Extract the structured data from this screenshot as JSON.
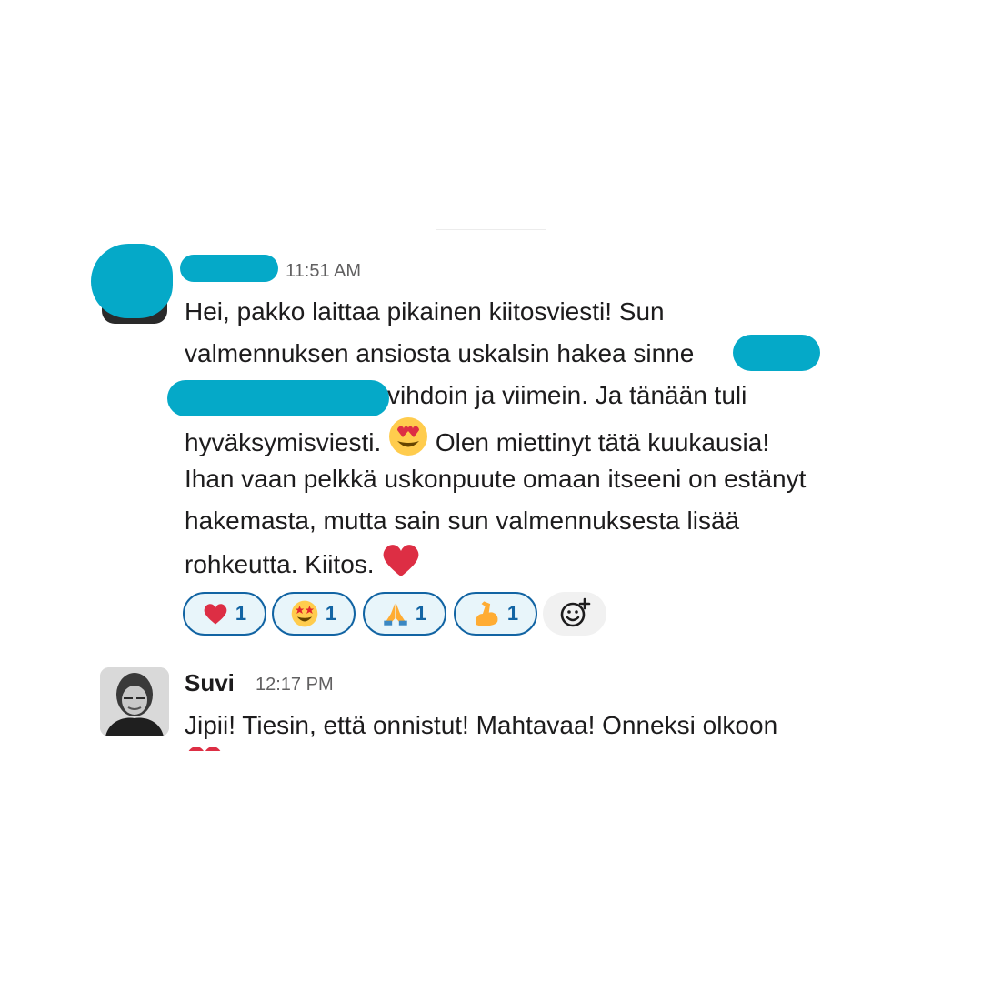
{
  "messages": [
    {
      "sender": "",
      "time": "11:51 AM",
      "lines": [
        "Hei, pakko laittaa pikainen kiitosviesti! Sun",
        "valmennuksen ansiosta uskalsin hakea sinne",
        " vihdoin ja viimein. Ja tänään tuli",
        "hyväksymisviesti.",
        " Olen miettinyt tätä kuukausia!",
        "Ihan vaan pelkkä uskonpuute omaan itseeni on estänyt",
        "hakemasta, mutta sain sun valmennuksesta lisää",
        "rohkeutta. Kiitos."
      ],
      "inline_emojis": [
        "heart-eyes-emoji",
        "red-heart-emoji"
      ],
      "reactions": [
        {
          "emoji": "red-heart",
          "count": "1"
        },
        {
          "emoji": "star-struck",
          "count": "1"
        },
        {
          "emoji": "folded-hands",
          "count": "1"
        },
        {
          "emoji": "flexed-biceps",
          "count": "1"
        }
      ],
      "add_reaction_icon": "add-reaction-icon"
    },
    {
      "sender": "Suvi",
      "time": "12:17 PM",
      "lines": [
        "Jipii! Tiesin, että onnistut! Mahtavaa! Onneksi olkoon"
      ]
    }
  ],
  "colors": {
    "redaction": "#05a9c8",
    "reaction_border": "#1264a3",
    "reaction_bg": "#e8f5fa",
    "heart": "#dd2e44"
  }
}
